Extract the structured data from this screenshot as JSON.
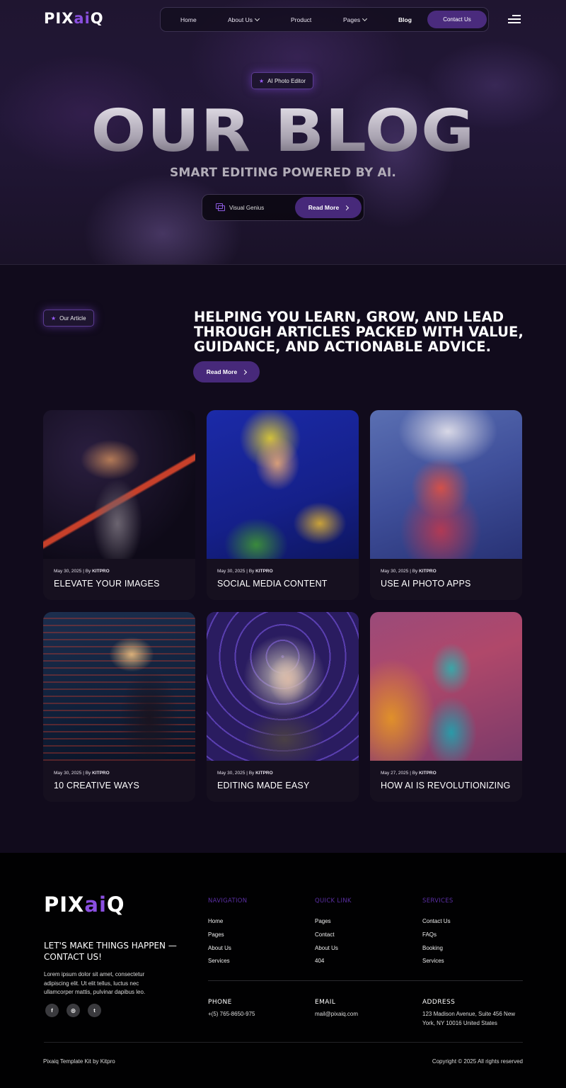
{
  "brand": {
    "logo_pre": "PIX",
    "logo_ai": "ai",
    "logo_post": "Q"
  },
  "nav": {
    "items": [
      "Home",
      "About Us",
      "Product",
      "Pages",
      "Blog"
    ],
    "contact_label": "Contact Us",
    "active": "Blog"
  },
  "hero": {
    "badge": "AI Photo Editor",
    "title": "OUR BLOG",
    "subtitle": "SMART EDITING POWERED BY AI.",
    "cta_label": "Visual Genius",
    "cta_button": "Read More"
  },
  "articles": {
    "badge": "Our Article",
    "heading": "HELPING YOU LEARN, GROW, AND LEAD THROUGH ARTICLES PACKED WITH VALUE, GUIDANCE, AND ACTIONABLE ADVICE.",
    "button": "Read More",
    "cards": [
      {
        "date": "May 30, 2025 | By ",
        "author": "KITPRO",
        "title": "ELEVATE YOUR IMAGES"
      },
      {
        "date": "May 30, 2025 | By ",
        "author": "KITPRO",
        "title": "SOCIAL MEDIA CONTENT"
      },
      {
        "date": "May 30, 2025 | By ",
        "author": "KITPRO",
        "title": "USE AI PHOTO APPS"
      },
      {
        "date": "May 30, 2025 | By ",
        "author": "KITPRO",
        "title": "10 CREATIVE WAYS"
      },
      {
        "date": "May 30, 2025 | By ",
        "author": "KITPRO",
        "title": "EDITING MADE EASY"
      },
      {
        "date": "May 27, 2025 | By ",
        "author": "KITPRO",
        "title": "HOW AI IS REVOLUTIONIZING"
      }
    ]
  },
  "footer": {
    "tagline": "LET'S MAKE THINGS HAPPEN — CONTACT US!",
    "description": "Lorem ipsum dolor sit amet, consectetur adipiscing elit. Ut elit tellus, luctus nec ullamcorper mattis, pulvinar dapibus leo.",
    "social": [
      "f",
      "◎",
      "t"
    ],
    "columns": [
      {
        "heading": "NAVIGATION",
        "links": [
          "Home",
          "Pages",
          "About Us",
          "Services"
        ]
      },
      {
        "heading": "QUICK LINK",
        "links": [
          "Pages",
          "Contact",
          "About Us",
          "404"
        ]
      },
      {
        "heading": "SERVICES",
        "links": [
          "Contact Us",
          "FAQs",
          "Booking",
          "Services"
        ]
      }
    ],
    "contact": [
      {
        "label": "PHONE",
        "value": "+(5) 765-8650-975"
      },
      {
        "label": "EMAIL",
        "value": "mail@pixaiq.com"
      },
      {
        "label": "ADDRESS",
        "value": "123 Madison Avenue, Suite 456 New York, NY 10016 United States"
      }
    ],
    "credit": "Pixaiq Template Kit by Kitpro",
    "copyright": "Copyright © 2025 All rights reserved"
  },
  "colors": {
    "accent": "#47297a",
    "brand_purple": "#8a4fe0",
    "background": "#110b1c"
  }
}
